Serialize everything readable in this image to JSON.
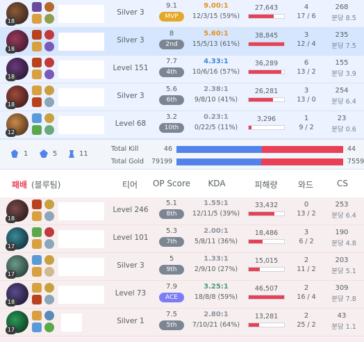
{
  "colors": {
    "win_bg": "#ecf2ff",
    "lose_bg": "#f7eeef",
    "highlight_bg": "#d6e6ff",
    "damage_bar": "#e84057",
    "blue_team": "#5383e8",
    "red_team": "#e84057",
    "mvp_badge": "#e3a826",
    "ace_badge": "#7c7cf5",
    "rank_badge": "#7c8693",
    "lose_label": "#e84057"
  },
  "win_team": {
    "players": [
      {
        "champion_icon": "champion-portrait-icon",
        "champ_level": "18",
        "tier": "Silver 3",
        "op_score": "9.1",
        "op_rank": "MVP",
        "kda_ratio": "9.00:1",
        "kda_detail": "12/3/15 (59%)",
        "damage": "27,643",
        "damage_fraction": 0.71,
        "wards_main": "4",
        "wards_sub": "17 / 6",
        "cs_main": "268",
        "cs_sub": "분당 8.5"
      },
      {
        "champion_icon": "champion-portrait-icon",
        "champ_level": "18",
        "tier": "Silver 3",
        "op_score": "8",
        "op_rank": "2nd",
        "kda_ratio": "5.60:1",
        "kda_detail": "15/5/13 (61%)",
        "damage": "38,845",
        "damage_fraction": 1.0,
        "wards_main": "3",
        "wards_sub": "12 / 4",
        "cs_main": "235",
        "cs_sub": "분당 7.5"
      },
      {
        "champion_icon": "champion-portrait-icon",
        "champ_level": "18",
        "tier": "Level 151",
        "op_score": "7.7",
        "op_rank": "4th",
        "kda_ratio": "4.33:1",
        "kda_detail": "10/6/16 (57%)",
        "damage": "36,289",
        "damage_fraction": 0.93,
        "wards_main": "6",
        "wards_sub": "13 / 2",
        "cs_main": "155",
        "cs_sub": "분당 3.9"
      },
      {
        "champion_icon": "champion-portrait-icon",
        "champ_level": "18",
        "tier": "Silver 3",
        "op_score": "5.6",
        "op_rank": "6th",
        "kda_ratio": "2.38:1",
        "kda_detail": "9/8/10 (41%)",
        "damage": "26,281",
        "damage_fraction": 0.68,
        "wards_main": "3",
        "wards_sub": "13 / 0",
        "cs_main": "254",
        "cs_sub": "분당 6.4"
      },
      {
        "champion_icon": "champion-portrait-icon",
        "champ_level": "12",
        "tier": "Level 68",
        "op_score": "3.2",
        "op_rank": "10th",
        "kda_ratio": "0.23:1",
        "kda_detail": "0/22/5 (11%)",
        "damage": "3,296",
        "damage_fraction": 0.08,
        "wards_main": "1",
        "wards_sub": "9 / 2",
        "cs_main": "23",
        "cs_sub": "분당 0.6"
      }
    ]
  },
  "summary": {
    "objectives": [
      {
        "icon": "baron-icon",
        "value": "1"
      },
      {
        "icon": "dragon-icon",
        "value": "5"
      },
      {
        "icon": "tower-icon",
        "value": "11"
      }
    ],
    "total_kill_label": "Total Kill",
    "total_kill_left": "46",
    "total_kill_right": "44",
    "total_kill_fraction": 0.511,
    "total_gold_label": "Total Gold",
    "total_gold_left": "79199",
    "total_gold_right": "7559",
    "total_gold_fraction": 0.51
  },
  "lose_header": {
    "result": "패배",
    "team": "(블루팀)",
    "col_tier": "티어",
    "col_op": "OP Score",
    "col_kda": "KDA",
    "col_damage": "피해량",
    "col_wards": "와드",
    "col_cs": "CS"
  },
  "lose_team": {
    "players": [
      {
        "champion_icon": "champion-portrait-icon",
        "champ_level": "18",
        "tier": "Level 246",
        "op_score": "5.1",
        "op_rank": "8th",
        "kda_ratio": "1.55:1",
        "kda_detail": "12/11/5 (39%)",
        "damage": "33,432",
        "damage_fraction": 0.72,
        "wards_main": "0",
        "wards_sub": "13 / 2",
        "cs_main": "253",
        "cs_sub": "분당 6.4"
      },
      {
        "champion_icon": "champion-portrait-icon",
        "champ_level": "17",
        "tier": "Level 101",
        "op_score": "5.3",
        "op_rank": "7th",
        "kda_ratio": "2.00:1",
        "kda_detail": "5/8/11 (36%)",
        "damage": "18,486",
        "damage_fraction": 0.4,
        "wards_main": "3",
        "wards_sub": "6 / 2",
        "cs_main": "190",
        "cs_sub": "분당 4.8"
      },
      {
        "champion_icon": "champion-portrait-icon",
        "champ_level": "17",
        "tier": "Silver 3",
        "op_score": "5",
        "op_rank": "9th",
        "kda_ratio": "1.33:1",
        "kda_detail": "2/9/10 (27%)",
        "damage": "15,015",
        "damage_fraction": 0.32,
        "wards_main": "2",
        "wards_sub": "11 / 2",
        "cs_main": "203",
        "cs_sub": "분당 5.1"
      },
      {
        "champion_icon": "champion-portrait-icon",
        "champ_level": "18",
        "tier": "Level 73",
        "op_score": "7.9",
        "op_rank": "ACE",
        "kda_ratio": "3.25:1",
        "kda_detail": "18/8/8 (59%)",
        "damage": "46,507",
        "damage_fraction": 1.0,
        "wards_main": "2",
        "wards_sub": "16 / 4",
        "cs_main": "309",
        "cs_sub": "분당 7.8"
      },
      {
        "champion_icon": "champion-portrait-icon",
        "champ_level": "17",
        "tier": "Silver 1",
        "op_score": "7.5",
        "op_rank": "5th",
        "kda_ratio": "2.80:1",
        "kda_detail": "7/10/21 (64%)",
        "damage": "13,281",
        "damage_fraction": 0.29,
        "wards_main": "2",
        "wards_sub": "25 / 2",
        "cs_main": "43",
        "cs_sub": "분당 1.1"
      }
    ]
  }
}
